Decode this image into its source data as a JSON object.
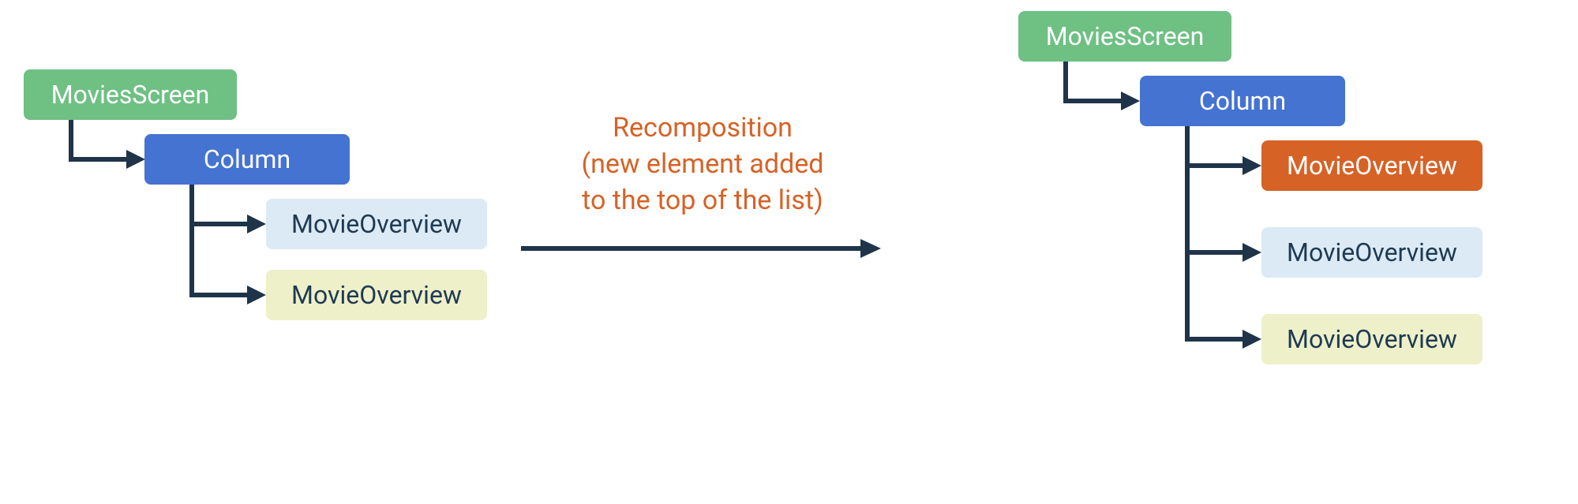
{
  "left_tree": {
    "root": "MoviesScreen",
    "column": "Column",
    "items": [
      "MovieOverview",
      "MovieOverview"
    ]
  },
  "right_tree": {
    "root": "MoviesScreen",
    "column": "Column",
    "items": [
      "MovieOverview",
      "MovieOverview",
      "MovieOverview"
    ]
  },
  "caption": {
    "line1": "Recomposition",
    "line2": "(new element added",
    "line3": "to the top of the list)"
  },
  "colors": {
    "green": "#6ec083",
    "blue": "#4573d1",
    "lightblue": "#dbeaf5",
    "lightyellow": "#eef0c9",
    "orange": "#d66226",
    "stroke": "#1f3449"
  }
}
